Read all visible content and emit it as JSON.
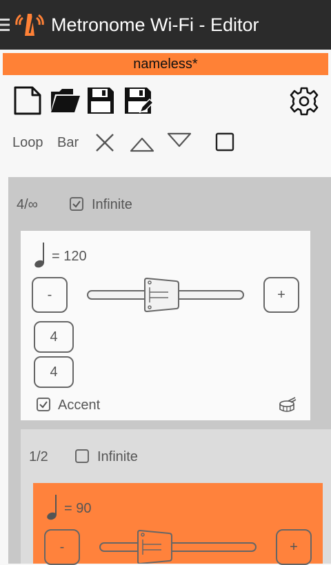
{
  "app": {
    "title": "Metronome Wi-Fi - Editor"
  },
  "file": {
    "name": "nameless*"
  },
  "toolbar": {
    "loop_label": "Loop",
    "bar_label": "Bar"
  },
  "colors": {
    "accent": "#ff8136",
    "appbar": "#2b2b2b"
  },
  "bars": [
    {
      "count": "4/∞",
      "infinite_label": "Infinite",
      "infinite_checked": true
    },
    {
      "count": "1/2",
      "infinite_label": "Infinite",
      "infinite_checked": false
    }
  ],
  "card1": {
    "tempo_text": "= 120",
    "minus_label": "-",
    "plus_label": "+",
    "beats": "4",
    "note_value": "4",
    "accent_label": "Accent",
    "accent_checked": true
  },
  "card2": {
    "tempo_text": "= 90",
    "minus_label": "-",
    "plus_label": "+"
  }
}
